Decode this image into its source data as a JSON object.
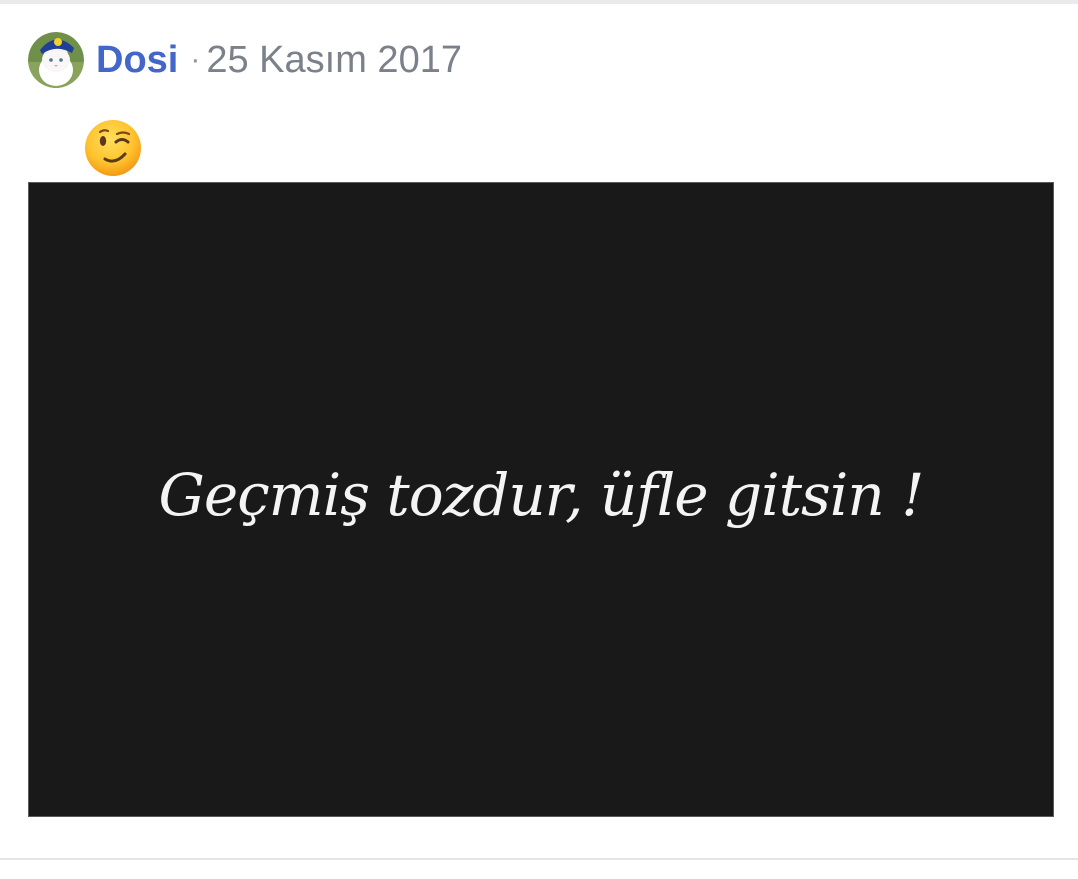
{
  "post": {
    "author": "Dosi",
    "separator": "·",
    "date": "25 Kasım 2017",
    "avatar": {
      "icon": "cat-avatar-icon",
      "description_colors": {
        "background": "#6f8f4a",
        "cap": "#1f3f99",
        "cap_badge": "#f2d22a",
        "cat": "#ffffff"
      }
    },
    "message_emoji": "wink-emoji-icon",
    "image": {
      "caption": "Geçmiş tozdur, üfle gitsin !",
      "background_color": "#191919",
      "text_color": "#f4f4f4"
    }
  },
  "theme": {
    "author_color": "#4267c8",
    "meta_color": "#7a818b",
    "divider_color": "#e4e5e8"
  }
}
